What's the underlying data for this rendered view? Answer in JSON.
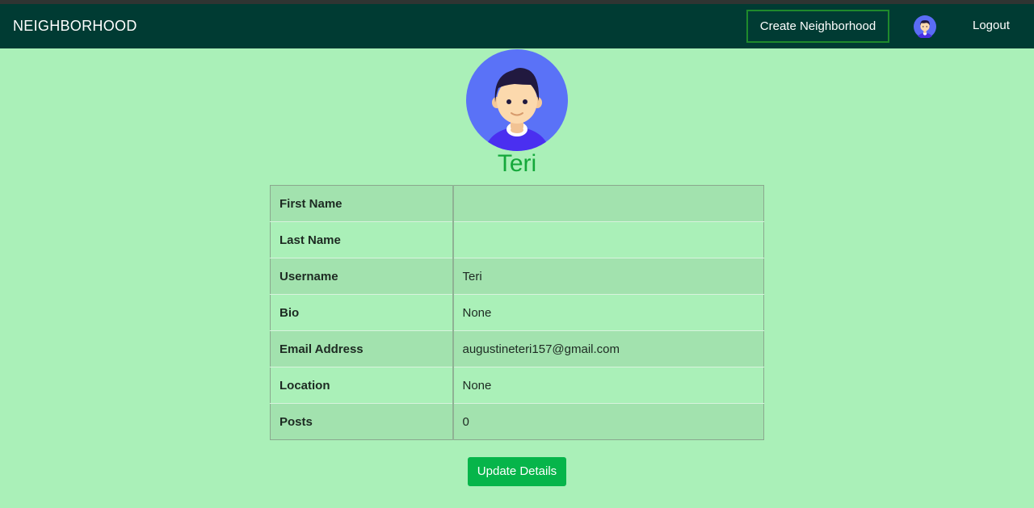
{
  "navbar": {
    "brand": "NEIGHBORHOOD",
    "create_label": "Create Neighborhood",
    "logout_label": "Logout",
    "background": "#003b33"
  },
  "profile": {
    "name": "Teri",
    "avatar_icon": "user-avatar-icon"
  },
  "details": {
    "rows": [
      {
        "label": "First Name",
        "value": ""
      },
      {
        "label": "Last Name",
        "value": ""
      },
      {
        "label": "Username",
        "value": "Teri"
      },
      {
        "label": "Bio",
        "value": "None"
      },
      {
        "label": "Email Address",
        "value": "augustineteri157@gmail.com"
      },
      {
        "label": "Location",
        "value": "None"
      },
      {
        "label": "Posts",
        "value": "0"
      }
    ]
  },
  "actions": {
    "update_label": "Update Details",
    "accent": "#06b54a"
  },
  "page": {
    "background": "#aaf0b8"
  }
}
